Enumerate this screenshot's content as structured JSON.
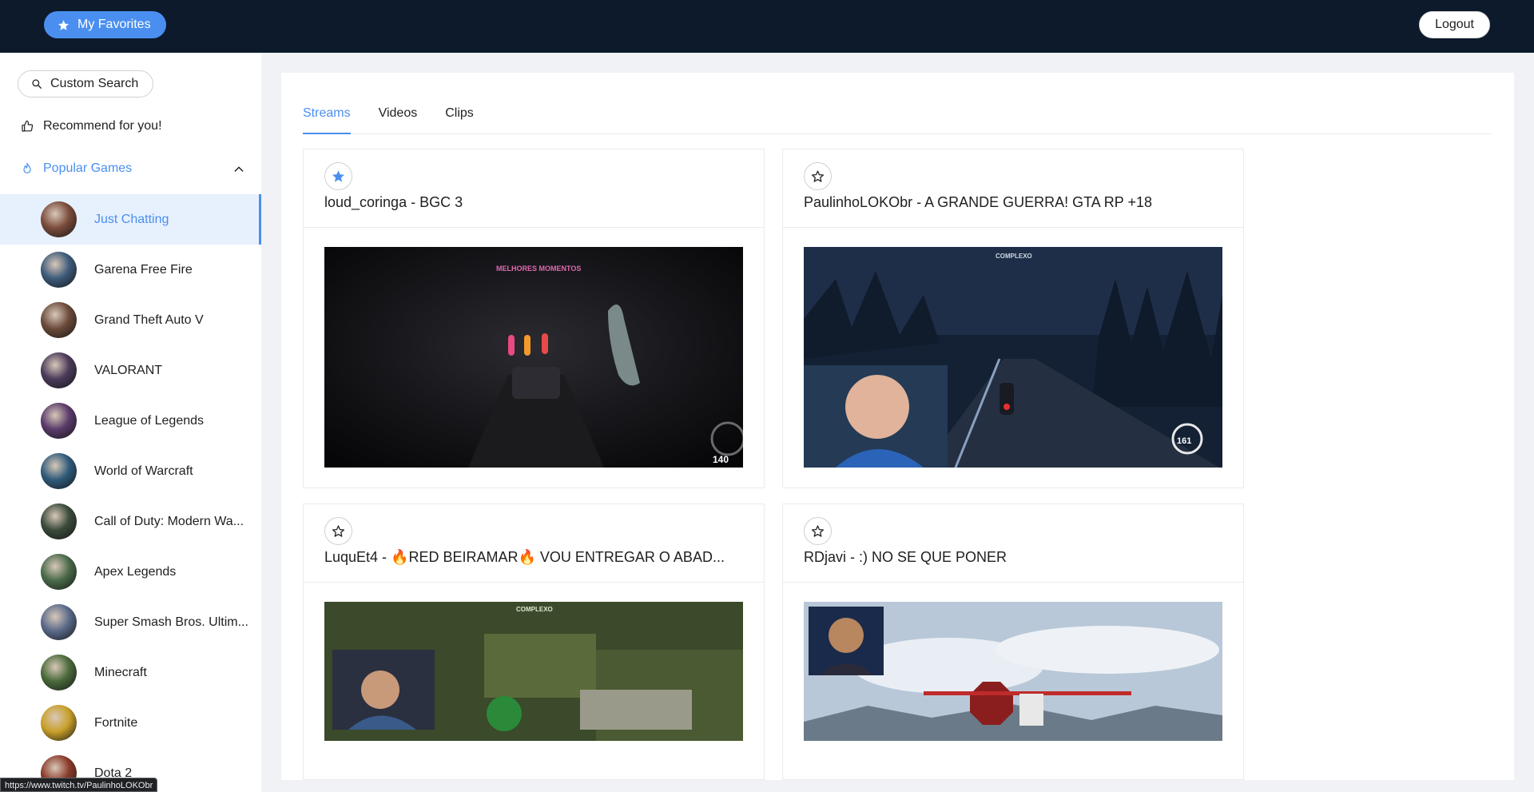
{
  "header": {
    "favorites_label": "My Favorites",
    "logout_label": "Logout"
  },
  "sidebar": {
    "search_label": "Custom Search",
    "recommend_label": "Recommend for you!",
    "popular_label": "Popular Games",
    "games": [
      {
        "name": "Just Chatting",
        "color": "#7a4b3a"
      },
      {
        "name": "Garena Free Fire",
        "color": "#3d5a7a"
      },
      {
        "name": "Grand Theft Auto V",
        "color": "#6b4a3a"
      },
      {
        "name": "VALORANT",
        "color": "#4a3a5a"
      },
      {
        "name": "League of Legends",
        "color": "#5a3a6a"
      },
      {
        "name": "World of Warcraft",
        "color": "#2f5a7a"
      },
      {
        "name": "Call of Duty: Modern Wa...",
        "color": "#3a4a3a"
      },
      {
        "name": "Apex Legends",
        "color": "#4a6a4a"
      },
      {
        "name": "Super Smash Bros. Ultim...",
        "color": "#5a6a8a"
      },
      {
        "name": "Minecraft",
        "color": "#4a6a3a"
      },
      {
        "name": "Fortnite",
        "color": "#c9a02a"
      },
      {
        "name": "Dota 2",
        "color": "#8a3a2a"
      }
    ]
  },
  "status_url": "https://www.twitch.tv/PaulinhoLOKObr",
  "tabs": [
    "Streams",
    "Videos",
    "Clips"
  ],
  "cards": [
    {
      "title": "loud_coringa - BGC 3",
      "favorited": true
    },
    {
      "title": "PaulinhoLOKObr - A GRANDE GUERRA! GTA RP +18",
      "favorited": false
    },
    {
      "title": "LuquEt4 - 🔥RED BEIRAMAR🔥 VOU ENTREGAR O ABAD...",
      "favorited": false
    },
    {
      "title": "RDjavi - :) NO SE QUE PONER",
      "favorited": false
    }
  ],
  "colors": {
    "accent": "#4a8ff0",
    "header_bg": "#0d1a2b"
  }
}
